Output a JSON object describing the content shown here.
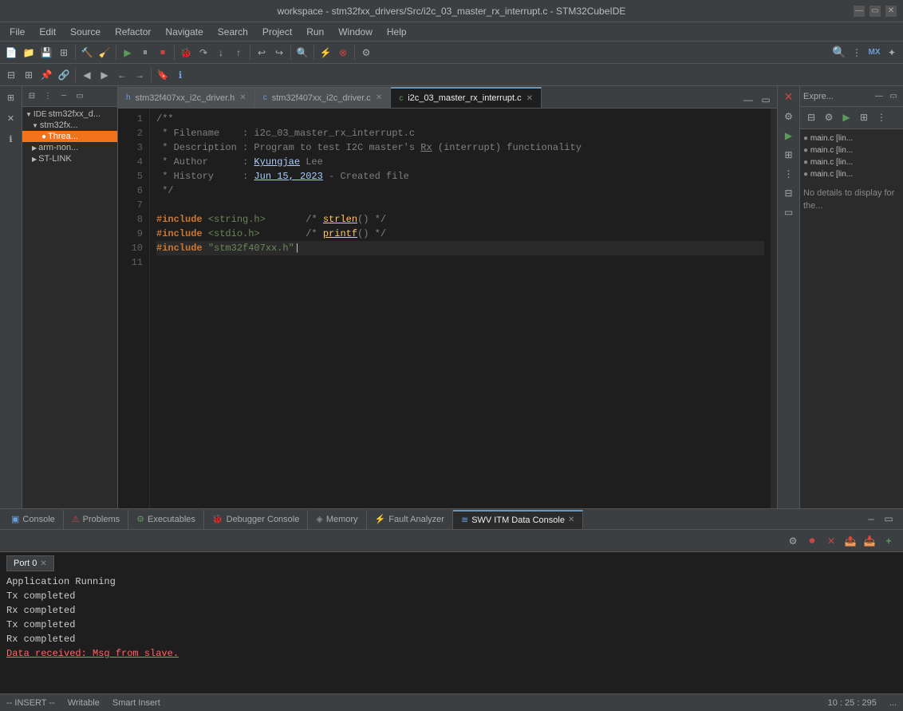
{
  "titlebar": {
    "title": "workspace - stm32fxx_drivers/Src/i2c_03_master_rx_interrupt.c - STM32CubeIDE"
  },
  "menubar": {
    "items": [
      "File",
      "Edit",
      "Source",
      "Refactor",
      "Navigate",
      "Search",
      "Project",
      "Run",
      "Window",
      "Help"
    ]
  },
  "editor": {
    "tabs": [
      {
        "label": "stm32f407xx_i2c_driver.h",
        "active": false,
        "icon": "h"
      },
      {
        "label": "stm32f407xx_i2c_driver.c",
        "active": false,
        "icon": "c"
      },
      {
        "label": "i2c_03_master_rx_interrupt.c",
        "active": true,
        "icon": "c"
      }
    ],
    "code_lines": [
      {
        "num": 1,
        "text": "/**"
      },
      {
        "num": 2,
        "text": " * Filename    : i2c_03_master_rx_interrupt.c"
      },
      {
        "num": 3,
        "text": " * Description : Program to test I2C master's Rx (interrupt) functionality"
      },
      {
        "num": 4,
        "text": " * Author      : Kyungjae Lee"
      },
      {
        "num": 5,
        "text": " * History     : Jun 15, 2023 - Created file"
      },
      {
        "num": 6,
        "text": " */"
      },
      {
        "num": 7,
        "text": ""
      },
      {
        "num": 8,
        "text": "#include <string.h>       /* strlen() */"
      },
      {
        "num": 9,
        "text": "#include <stdio.h>        /* printf() */"
      },
      {
        "num": 10,
        "text": "#include \"stm32f407xx.h\"|"
      },
      {
        "num": 11,
        "text": ""
      }
    ]
  },
  "project_explorer": {
    "items": [
      {
        "label": "stm32fxx_d...",
        "level": 0,
        "type": "project",
        "expanded": true
      },
      {
        "label": "stm32fx...",
        "level": 1,
        "type": "folder",
        "expanded": true
      },
      {
        "label": "Threa...",
        "level": 2,
        "type": "file",
        "selected": true
      },
      {
        "label": "arm-non...",
        "level": 1,
        "type": "folder"
      },
      {
        "label": "ST-LINK",
        "level": 1,
        "type": "folder"
      }
    ]
  },
  "right_panel": {
    "label": "Expre...",
    "items": [
      "main.c [lin...",
      "main.c [lin...",
      "main.c [lin...",
      "main.c [lin..."
    ],
    "no_details": "No details to display for the..."
  },
  "bottom_panel": {
    "tabs": [
      {
        "label": "Console",
        "icon": "console",
        "active": false
      },
      {
        "label": "Problems",
        "icon": "problems",
        "active": false
      },
      {
        "label": "Executables",
        "icon": "exec",
        "active": false
      },
      {
        "label": "Debugger Console",
        "icon": "debug",
        "active": false
      },
      {
        "label": "Memory",
        "icon": "memory",
        "active": false
      },
      {
        "label": "Fault Analyzer",
        "icon": "fault",
        "active": false
      },
      {
        "label": "SWV ITM Data Console",
        "icon": "swv",
        "active": true
      }
    ],
    "port_tab": "Port 0",
    "console_lines": [
      {
        "text": "Application Running",
        "style": "normal"
      },
      {
        "text": "Tx completed",
        "style": "normal"
      },
      {
        "text": "Rx completed",
        "style": "normal"
      },
      {
        "text": "Tx completed",
        "style": "normal"
      },
      {
        "text": "Rx completed",
        "style": "normal"
      },
      {
        "text": "Data received: Msg from slave.",
        "style": "underline"
      }
    ]
  },
  "statusbar": {
    "mode": "-- INSERT --",
    "writable": "Writable",
    "smart_insert": "Smart Insert",
    "position": "10 : 25 : 295",
    "dots": "..."
  }
}
